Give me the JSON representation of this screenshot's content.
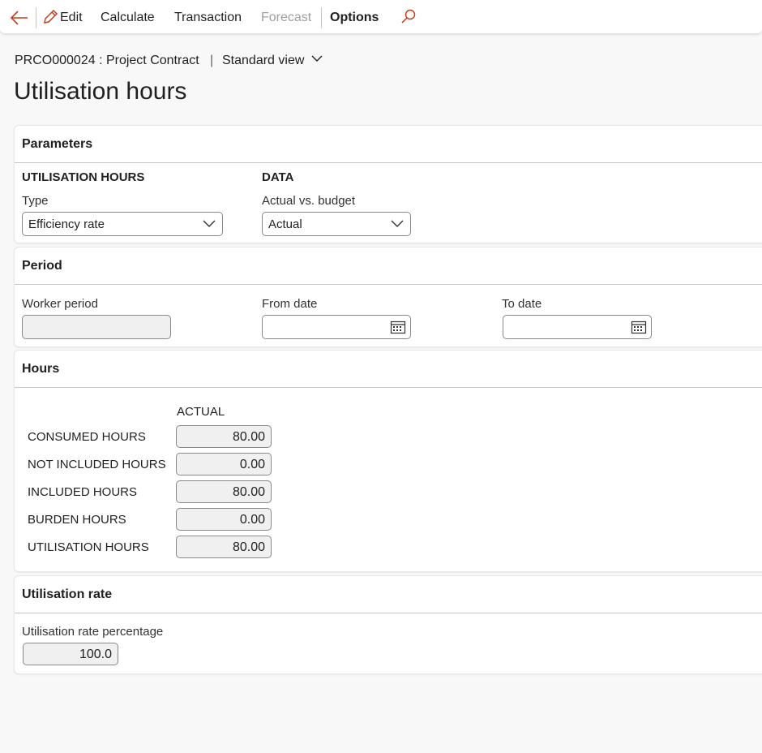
{
  "toolbar": {
    "edit_label": "Edit",
    "calculate_label": "Calculate",
    "transaction_label": "Transaction",
    "forecast_label": "Forecast",
    "options_label": "Options"
  },
  "header": {
    "breadcrumb": "PRCO000024 : Project Contract",
    "view_label": "Standard view",
    "title": "Utilisation hours"
  },
  "parameters": {
    "title": "Parameters",
    "utilisation_group": "UTILISATION HOURS",
    "type_label": "Type",
    "type_value": "Efficiency rate",
    "data_group": "DATA",
    "actual_budget_label": "Actual vs. budget",
    "actual_budget_value": "Actual"
  },
  "period": {
    "title": "Period",
    "worker_period_label": "Worker period",
    "worker_period_value": "",
    "from_date_label": "From date",
    "from_date_value": "",
    "to_date_label": "To date",
    "to_date_value": ""
  },
  "hours": {
    "title": "Hours",
    "column_header": "ACTUAL",
    "rows": [
      {
        "label": "CONSUMED HOURS",
        "value": "80.00"
      },
      {
        "label": "NOT INCLUDED HOURS",
        "value": "0.00"
      },
      {
        "label": "INCLUDED HOURS",
        "value": "80.00"
      },
      {
        "label": "BURDEN HOURS",
        "value": "0.00"
      },
      {
        "label": "UTILISATION HOURS",
        "value": "80.00"
      }
    ]
  },
  "utilisation_rate": {
    "title": "Utilisation rate",
    "percentage_label": "Utilisation rate percentage",
    "percentage_value": "100.0"
  },
  "colors": {
    "accent": "#c43e1c",
    "disabled_text": "#a19f9d"
  }
}
